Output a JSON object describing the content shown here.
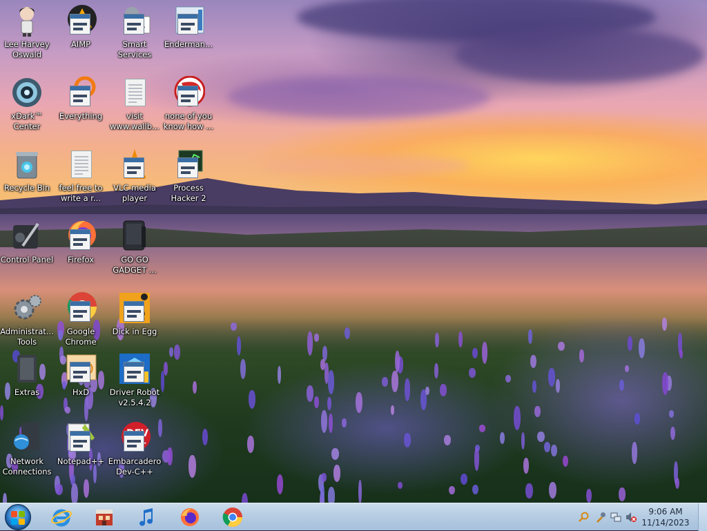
{
  "desktop": {
    "icons": [
      {
        "label": "Lee Harvey Oswald",
        "icon": "character-icon"
      },
      {
        "label": "AIMP",
        "icon": "aimp-icon"
      },
      {
        "label": "Smart Services",
        "icon": "gear-window-icon"
      },
      {
        "label": "Enderman...",
        "icon": "window-app-icon"
      },
      {
        "label": "xDark™ Center",
        "icon": "xdark-icon"
      },
      {
        "label": "Everything",
        "icon": "everything-search-icon"
      },
      {
        "label": "visit www.wallb...",
        "icon": "text-document-icon"
      },
      {
        "label": "none of you know how ...",
        "icon": "red-swirl-icon"
      },
      {
        "label": "Recycle Bin",
        "icon": "recycle-bin-icon"
      },
      {
        "label": "feel free to write a r...",
        "icon": "text-document-icon"
      },
      {
        "label": "VLC media player",
        "icon": "vlc-cone-icon"
      },
      {
        "label": "Process Hacker 2",
        "icon": "process-hacker-icon"
      },
      {
        "label": "Control Panel",
        "icon": "control-panel-icon"
      },
      {
        "label": "Firefox",
        "icon": "firefox-icon"
      },
      {
        "label": "GO GO GADGET ...",
        "icon": "gadget-icon"
      },
      {
        "label": "Administrat... Tools",
        "icon": "admin-tools-gear-icon"
      },
      {
        "label": "Google Chrome",
        "icon": "chrome-icon"
      },
      {
        "label": "Dick in Egg",
        "icon": "egg-app-icon"
      },
      {
        "label": "Extras",
        "icon": "extras-folder-icon"
      },
      {
        "label": "HxD",
        "icon": "hxd-icon"
      },
      {
        "label": "Driver Robot v2.5.4.2",
        "icon": "driver-robot-icon"
      },
      {
        "label": "Network Connections",
        "icon": "network-globe-icon"
      },
      {
        "label": "Notepad++",
        "icon": "notepad-plus-icon"
      },
      {
        "label": "Embarcadero Dev-C++",
        "icon": "dev-cpp-icon"
      }
    ]
  },
  "taskbar": {
    "pinned": [
      {
        "name": "internet-explorer-icon"
      },
      {
        "name": "store-icon"
      },
      {
        "name": "music-player-icon"
      },
      {
        "name": "firefox-icon"
      },
      {
        "name": "chrome-icon"
      }
    ],
    "tray": [
      {
        "name": "search-tray-icon"
      },
      {
        "name": "tools-tray-icon"
      },
      {
        "name": "network-tray-icon"
      },
      {
        "name": "volume-muted-icon"
      }
    ],
    "clock": {
      "time": "9:06 AM",
      "date": "11/14/2023"
    }
  },
  "colors": {
    "taskbar_top": "#cbdcec",
    "taskbar_bottom": "#a6c0dc",
    "label_text": "#ffffff"
  }
}
